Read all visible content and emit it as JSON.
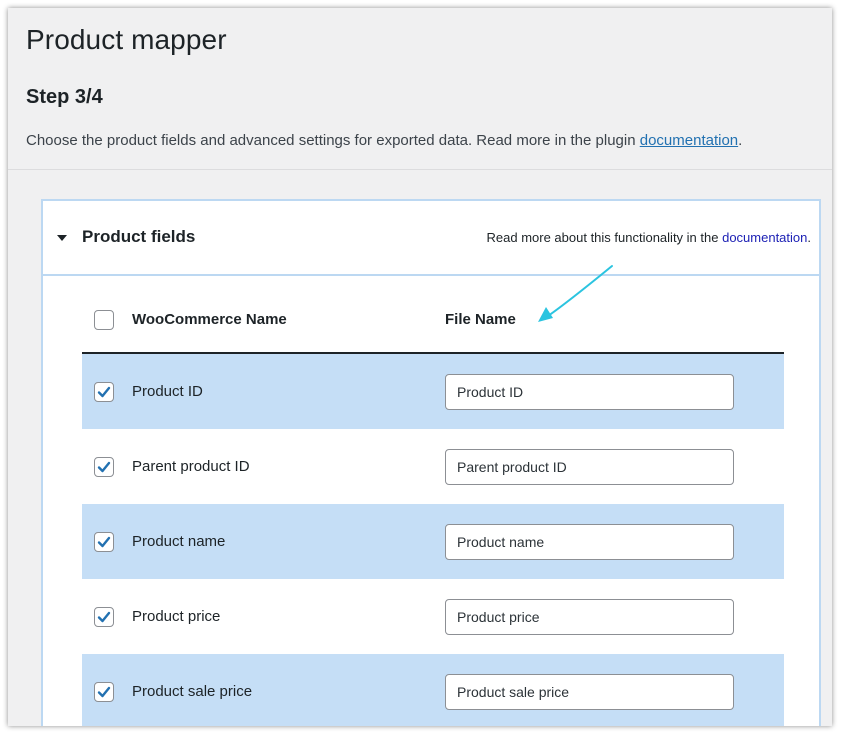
{
  "page": {
    "title": "Product mapper",
    "step": "Step 3/4",
    "intro_text": "Choose the product fields and advanced settings for exported data. Read more in the plugin ",
    "intro_link": "documentation",
    "intro_end": "."
  },
  "panel": {
    "title": "Product fields",
    "note_text": "Read more about this functionality in the ",
    "note_link": "documentation",
    "note_end": ".",
    "expanded": true
  },
  "table": {
    "col_name": "WooCommerce Name",
    "col_file": "File Name",
    "select_all_checked": false,
    "rows": [
      {
        "name": "Product ID",
        "file_name": "Product ID",
        "checked": true
      },
      {
        "name": "Parent product ID",
        "file_name": "Parent product ID",
        "checked": true
      },
      {
        "name": "Product name",
        "file_name": "Product name",
        "checked": true
      },
      {
        "name": "Product price",
        "file_name": "Product price",
        "checked": true
      },
      {
        "name": "Product sale price",
        "file_name": "Product sale price",
        "checked": true
      }
    ]
  },
  "colors": {
    "accent": "#2271b1",
    "row_highlight": "#c5def6",
    "annotation_arrow": "#2bc4e0"
  },
  "icons": {
    "caret": "caret-down-icon",
    "check": "checkmark-icon",
    "annotation": "annotation-arrow-icon"
  }
}
